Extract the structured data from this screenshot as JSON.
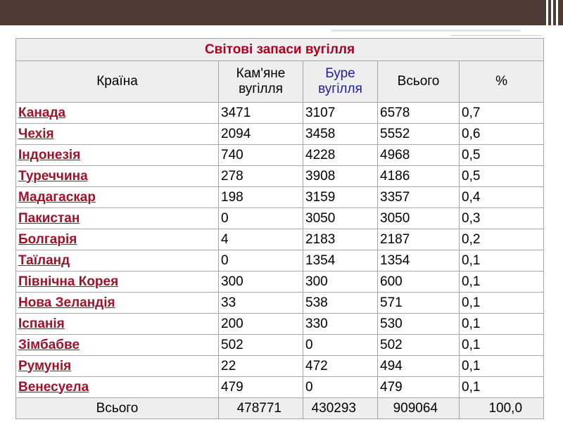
{
  "table": {
    "title": "Світові запаси вугілля",
    "headers": {
      "country": "Країна",
      "hard": "Кам'яне вугілля",
      "brown": "Буре вугілля",
      "total": "Всього",
      "percent": "%"
    },
    "rows": [
      {
        "country": "Канада",
        "hard": "3471",
        "brown": "3107",
        "total": "6578",
        "percent": "0,7"
      },
      {
        "country": "Чехія",
        "hard": "2094",
        "brown": "3458",
        "total": "5552",
        "percent": "0,6"
      },
      {
        "country": "Індонезія",
        "hard": "740",
        "brown": "4228",
        "total": "4968",
        "percent": "0,5"
      },
      {
        "country": "Туреччина",
        "hard": "278",
        "brown": "3908",
        "total": "4186",
        "percent": "0,5"
      },
      {
        "country": "Мадагаскар",
        "hard": "198",
        "brown": "3159",
        "total": "3357",
        "percent": "0,4"
      },
      {
        "country": "Пакистан",
        "hard": "0",
        "brown": "3050",
        "total": "3050",
        "percent": "0,3"
      },
      {
        "country": "Болгарія",
        "hard": "4",
        "brown": "2183",
        "total": "2187",
        "percent": "0,2"
      },
      {
        "country": "Таїланд",
        "hard": "0",
        "brown": "1354",
        "total": "1354",
        "percent": "0,1"
      },
      {
        "country": "Північна Корея",
        "hard": "300",
        "brown": "300",
        "total": "600",
        "percent": "0,1"
      },
      {
        "country": "Нова Зеландія",
        "hard": "33",
        "brown": "538",
        "total": "571",
        "percent": "0,1"
      },
      {
        "country": "Іспанія",
        "hard": "200",
        "brown": "330",
        "total": "530",
        "percent": "0,1"
      },
      {
        "country": "Зімбабве",
        "hard": "502",
        "brown": "0",
        "total": "502",
        "percent": "0,1"
      },
      {
        "country": "Румунія",
        "hard": "22",
        "brown": "472",
        "total": "494",
        "percent": "0,1"
      },
      {
        "country": "Венесуела",
        "hard": "479",
        "brown": "0",
        "total": "479",
        "percent": "0,1"
      }
    ],
    "totals": {
      "label": "Всього",
      "hard": "478771",
      "brown": "430293",
      "total": "909064",
      "percent": "100,0"
    }
  },
  "colors": {
    "band": "#4e3b35",
    "country": "#a0122a",
    "title": "#b00020",
    "brown_header": "#1f1f9a"
  }
}
